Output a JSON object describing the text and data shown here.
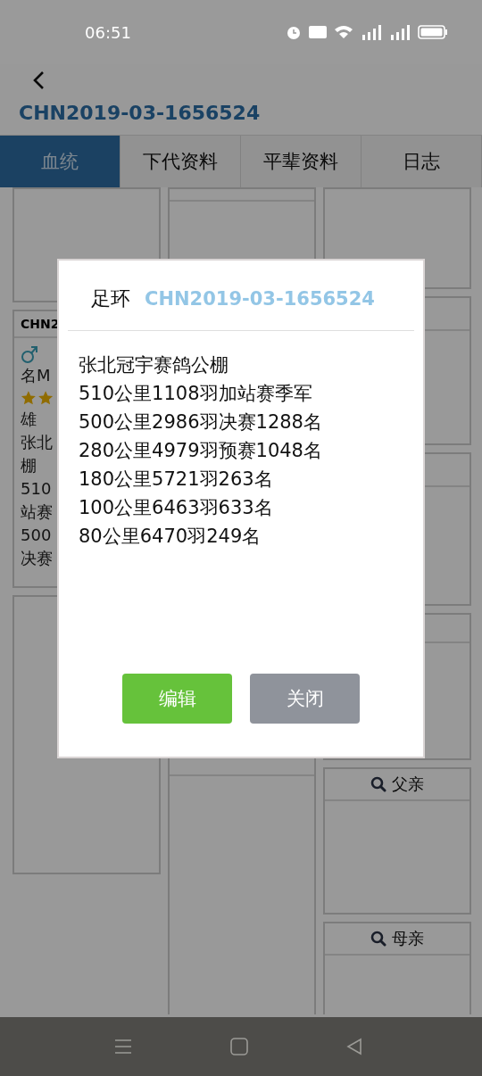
{
  "status_bar": {
    "time": "06:51"
  },
  "header": {
    "title": "CHN2019-03-1656524"
  },
  "tabs": [
    {
      "label": "血统",
      "selected": true
    },
    {
      "label": "下代资料",
      "selected": false
    },
    {
      "label": "平辈资料",
      "selected": false
    },
    {
      "label": "日志",
      "selected": false
    }
  ],
  "pedigree": {
    "columns": [
      {
        "cards": [
          {
            "kind": "empty"
          },
          {
            "kind": "bird",
            "ring": "CHN2",
            "name": "名M",
            "lines": [
              "雄",
              "张北",
              "棚",
              "510",
              "站赛",
              "500",
              "决赛"
            ]
          },
          {
            "kind": "empty"
          }
        ]
      },
      {
        "cards": [
          {
            "kind": "parent"
          },
          {
            "kind": "parent"
          }
        ]
      },
      {
        "cards": [
          {
            "kind": "empty"
          },
          {
            "kind": "parent"
          },
          {
            "kind": "parent"
          },
          {
            "kind": "parent"
          },
          {
            "kind": "parent",
            "label": "父亲"
          },
          {
            "kind": "parent",
            "label": "母亲"
          }
        ]
      }
    ]
  },
  "dialog": {
    "label": "足环",
    "ring": "CHN2019-03-1656524",
    "lines": [
      "张北冠宇赛鸽公棚",
      "510公里1108羽加站赛季军",
      "500公里2986羽决赛1288名",
      "280公里4979羽预赛1048名",
      "180公里5721羽263名",
      "100公里6463羽633名",
      "80公里6470羽249名"
    ],
    "buttons": [
      {
        "label": "编辑",
        "kind": "primary"
      },
      {
        "label": "关闭",
        "kind": "secondary"
      }
    ]
  }
}
